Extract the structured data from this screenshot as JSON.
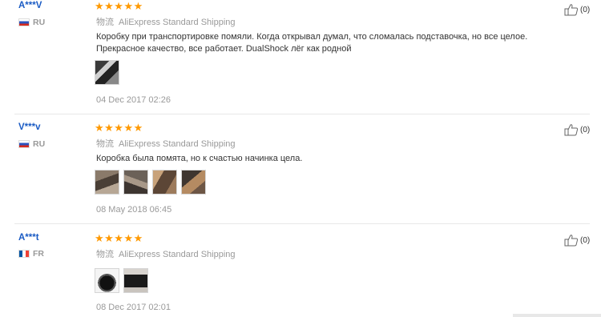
{
  "reviews": [
    {
      "user": "A***V",
      "country": "RU",
      "stars": "★★★★★",
      "shipping_label": "物流",
      "shipping": "AliExpress Standard Shipping",
      "text": "Коробку при транспортировке помяли. Когда открывал думал, что сломалась подставочка, но все целое. Прекрасное качество, все работает. DualShock лёг как родной",
      "date": "04 Dec 2017 02:26",
      "helpful_count": "(0)"
    },
    {
      "user": "V***v",
      "country": "RU",
      "stars": "★★★★★",
      "shipping_label": "物流",
      "shipping": "AliExpress Standard Shipping",
      "text": "Коробка была помята, но к счастью начинка цела.",
      "date": "08 May 2018 06:45",
      "helpful_count": "(0)"
    },
    {
      "user": "A***t",
      "country": "FR",
      "stars": "★★★★★",
      "shipping_label": "物流",
      "shipping": "AliExpress Standard Shipping",
      "text": "",
      "date": "08 Dec 2017 02:01",
      "helpful_count": "(0)"
    }
  ]
}
